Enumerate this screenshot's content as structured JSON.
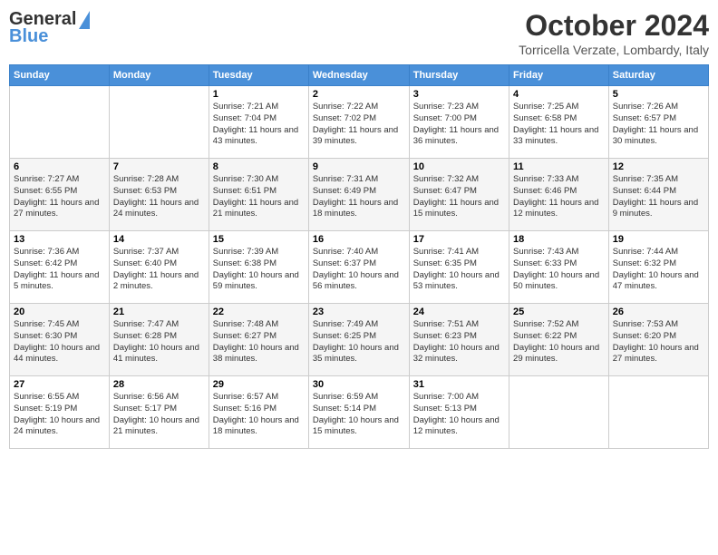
{
  "header": {
    "logo_general": "General",
    "logo_blue": "Blue",
    "month": "October 2024",
    "location": "Torricella Verzate, Lombardy, Italy"
  },
  "days_of_week": [
    "Sunday",
    "Monday",
    "Tuesday",
    "Wednesday",
    "Thursday",
    "Friday",
    "Saturday"
  ],
  "weeks": [
    [
      {
        "day": "",
        "sunrise": "",
        "sunset": "",
        "daylight": ""
      },
      {
        "day": "",
        "sunrise": "",
        "sunset": "",
        "daylight": ""
      },
      {
        "day": "1",
        "sunrise": "Sunrise: 7:21 AM",
        "sunset": "Sunset: 7:04 PM",
        "daylight": "Daylight: 11 hours and 43 minutes."
      },
      {
        "day": "2",
        "sunrise": "Sunrise: 7:22 AM",
        "sunset": "Sunset: 7:02 PM",
        "daylight": "Daylight: 11 hours and 39 minutes."
      },
      {
        "day": "3",
        "sunrise": "Sunrise: 7:23 AM",
        "sunset": "Sunset: 7:00 PM",
        "daylight": "Daylight: 11 hours and 36 minutes."
      },
      {
        "day": "4",
        "sunrise": "Sunrise: 7:25 AM",
        "sunset": "Sunset: 6:58 PM",
        "daylight": "Daylight: 11 hours and 33 minutes."
      },
      {
        "day": "5",
        "sunrise": "Sunrise: 7:26 AM",
        "sunset": "Sunset: 6:57 PM",
        "daylight": "Daylight: 11 hours and 30 minutes."
      }
    ],
    [
      {
        "day": "6",
        "sunrise": "Sunrise: 7:27 AM",
        "sunset": "Sunset: 6:55 PM",
        "daylight": "Daylight: 11 hours and 27 minutes."
      },
      {
        "day": "7",
        "sunrise": "Sunrise: 7:28 AM",
        "sunset": "Sunset: 6:53 PM",
        "daylight": "Daylight: 11 hours and 24 minutes."
      },
      {
        "day": "8",
        "sunrise": "Sunrise: 7:30 AM",
        "sunset": "Sunset: 6:51 PM",
        "daylight": "Daylight: 11 hours and 21 minutes."
      },
      {
        "day": "9",
        "sunrise": "Sunrise: 7:31 AM",
        "sunset": "Sunset: 6:49 PM",
        "daylight": "Daylight: 11 hours and 18 minutes."
      },
      {
        "day": "10",
        "sunrise": "Sunrise: 7:32 AM",
        "sunset": "Sunset: 6:47 PM",
        "daylight": "Daylight: 11 hours and 15 minutes."
      },
      {
        "day": "11",
        "sunrise": "Sunrise: 7:33 AM",
        "sunset": "Sunset: 6:46 PM",
        "daylight": "Daylight: 11 hours and 12 minutes."
      },
      {
        "day": "12",
        "sunrise": "Sunrise: 7:35 AM",
        "sunset": "Sunset: 6:44 PM",
        "daylight": "Daylight: 11 hours and 9 minutes."
      }
    ],
    [
      {
        "day": "13",
        "sunrise": "Sunrise: 7:36 AM",
        "sunset": "Sunset: 6:42 PM",
        "daylight": "Daylight: 11 hours and 5 minutes."
      },
      {
        "day": "14",
        "sunrise": "Sunrise: 7:37 AM",
        "sunset": "Sunset: 6:40 PM",
        "daylight": "Daylight: 11 hours and 2 minutes."
      },
      {
        "day": "15",
        "sunrise": "Sunrise: 7:39 AM",
        "sunset": "Sunset: 6:38 PM",
        "daylight": "Daylight: 10 hours and 59 minutes."
      },
      {
        "day": "16",
        "sunrise": "Sunrise: 7:40 AM",
        "sunset": "Sunset: 6:37 PM",
        "daylight": "Daylight: 10 hours and 56 minutes."
      },
      {
        "day": "17",
        "sunrise": "Sunrise: 7:41 AM",
        "sunset": "Sunset: 6:35 PM",
        "daylight": "Daylight: 10 hours and 53 minutes."
      },
      {
        "day": "18",
        "sunrise": "Sunrise: 7:43 AM",
        "sunset": "Sunset: 6:33 PM",
        "daylight": "Daylight: 10 hours and 50 minutes."
      },
      {
        "day": "19",
        "sunrise": "Sunrise: 7:44 AM",
        "sunset": "Sunset: 6:32 PM",
        "daylight": "Daylight: 10 hours and 47 minutes."
      }
    ],
    [
      {
        "day": "20",
        "sunrise": "Sunrise: 7:45 AM",
        "sunset": "Sunset: 6:30 PM",
        "daylight": "Daylight: 10 hours and 44 minutes."
      },
      {
        "day": "21",
        "sunrise": "Sunrise: 7:47 AM",
        "sunset": "Sunset: 6:28 PM",
        "daylight": "Daylight: 10 hours and 41 minutes."
      },
      {
        "day": "22",
        "sunrise": "Sunrise: 7:48 AM",
        "sunset": "Sunset: 6:27 PM",
        "daylight": "Daylight: 10 hours and 38 minutes."
      },
      {
        "day": "23",
        "sunrise": "Sunrise: 7:49 AM",
        "sunset": "Sunset: 6:25 PM",
        "daylight": "Daylight: 10 hours and 35 minutes."
      },
      {
        "day": "24",
        "sunrise": "Sunrise: 7:51 AM",
        "sunset": "Sunset: 6:23 PM",
        "daylight": "Daylight: 10 hours and 32 minutes."
      },
      {
        "day": "25",
        "sunrise": "Sunrise: 7:52 AM",
        "sunset": "Sunset: 6:22 PM",
        "daylight": "Daylight: 10 hours and 29 minutes."
      },
      {
        "day": "26",
        "sunrise": "Sunrise: 7:53 AM",
        "sunset": "Sunset: 6:20 PM",
        "daylight": "Daylight: 10 hours and 27 minutes."
      }
    ],
    [
      {
        "day": "27",
        "sunrise": "Sunrise: 6:55 AM",
        "sunset": "Sunset: 5:19 PM",
        "daylight": "Daylight: 10 hours and 24 minutes."
      },
      {
        "day": "28",
        "sunrise": "Sunrise: 6:56 AM",
        "sunset": "Sunset: 5:17 PM",
        "daylight": "Daylight: 10 hours and 21 minutes."
      },
      {
        "day": "29",
        "sunrise": "Sunrise: 6:57 AM",
        "sunset": "Sunset: 5:16 PM",
        "daylight": "Daylight: 10 hours and 18 minutes."
      },
      {
        "day": "30",
        "sunrise": "Sunrise: 6:59 AM",
        "sunset": "Sunset: 5:14 PM",
        "daylight": "Daylight: 10 hours and 15 minutes."
      },
      {
        "day": "31",
        "sunrise": "Sunrise: 7:00 AM",
        "sunset": "Sunset: 5:13 PM",
        "daylight": "Daylight: 10 hours and 12 minutes."
      },
      {
        "day": "",
        "sunrise": "",
        "sunset": "",
        "daylight": ""
      },
      {
        "day": "",
        "sunrise": "",
        "sunset": "",
        "daylight": ""
      }
    ]
  ]
}
